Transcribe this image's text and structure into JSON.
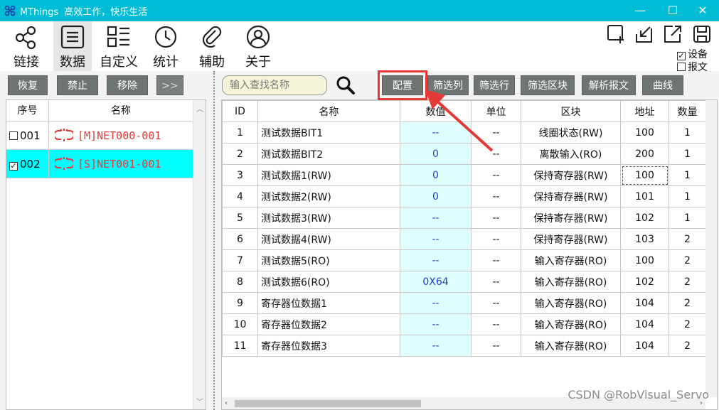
{
  "window": {
    "app_name": "MThings",
    "subtitle": "高效工作，快乐生活",
    "controls": {
      "minimize": "—",
      "maximize": "☐",
      "close": "✕"
    }
  },
  "toolbar": {
    "items": [
      {
        "label": "链接",
        "icon": "share-icon"
      },
      {
        "label": "数据",
        "icon": "list-icon",
        "active": true
      },
      {
        "label": "自定义",
        "icon": "grid-list-icon"
      },
      {
        "label": "统计",
        "icon": "clock-icon"
      },
      {
        "label": "辅助",
        "icon": "paperclip-icon"
      },
      {
        "label": "关于",
        "icon": "user-icon"
      }
    ],
    "right_icons": [
      "add-window-icon",
      "arrow-in-icon",
      "arrow-out-icon",
      "save-icon"
    ],
    "options": [
      {
        "label": "设备",
        "checked": true
      },
      {
        "label": "报文",
        "checked": false
      }
    ]
  },
  "left_toolbar": {
    "restore": "恢复",
    "disable": "禁止",
    "remove": "移除",
    "expand": ">>"
  },
  "device_list": {
    "headers": {
      "no": "序号",
      "name": "名称"
    },
    "rows": [
      {
        "checked": false,
        "no": "001",
        "name": "[M]NET000-001",
        "selected": false
      },
      {
        "checked": true,
        "no": "002",
        "name": "[S]NET001-001",
        "selected": true
      }
    ]
  },
  "search": {
    "placeholder": "输入查找名称"
  },
  "actions": {
    "config": "配置",
    "filter_cols": "筛选列",
    "filter_rows": "筛选行",
    "filter_blocks": "筛选区块",
    "parse_msg": "解析报文",
    "curve": "曲线"
  },
  "data_table": {
    "headers": [
      "ID",
      "名称",
      "数值",
      "单位",
      "区块",
      "地址",
      "数量"
    ],
    "rows": [
      [
        "1",
        "测试数据BIT1",
        "--",
        "--",
        "线圈状态(RW)",
        "100",
        "1"
      ],
      [
        "2",
        "测试数据BIT2",
        "0",
        "--",
        "离散输入(RO)",
        "200",
        "1"
      ],
      [
        "3",
        "测试数据1(RW)",
        "0",
        "--",
        "保持寄存器(RW)",
        "100",
        "1"
      ],
      [
        "4",
        "测试数据2(RW)",
        "0",
        "--",
        "保持寄存器(RW)",
        "101",
        "1"
      ],
      [
        "5",
        "测试数据3(RW)",
        "--",
        "--",
        "保持寄存器(RW)",
        "102",
        "1"
      ],
      [
        "6",
        "测试数据4(RW)",
        "--",
        "--",
        "保持寄存器(RW)",
        "103",
        "2"
      ],
      [
        "7",
        "测试数据5(RO)",
        "--",
        "--",
        "输入寄存器(RO)",
        "100",
        "2"
      ],
      [
        "8",
        "测试数据6(RO)",
        "0X64",
        "--",
        "输入寄存器(RO)",
        "102",
        "2"
      ],
      [
        "9",
        "寄存器位数据1",
        "--",
        "--",
        "输入寄存器(RO)",
        "104",
        "2"
      ],
      [
        "10",
        "寄存器位数据2",
        "--",
        "--",
        "输入寄存器(RO)",
        "104",
        "2"
      ],
      [
        "11",
        "寄存器位数据3",
        "--",
        "--",
        "输入寄存器(RO)",
        "104",
        "2"
      ]
    ]
  },
  "watermark": "CSDN @RobVisual_Servo",
  "colors": {
    "title_bar": "#00bcd4",
    "selected_row": "#00ffff",
    "value_cell": "#e0ffff",
    "highlight": "#e53935"
  }
}
